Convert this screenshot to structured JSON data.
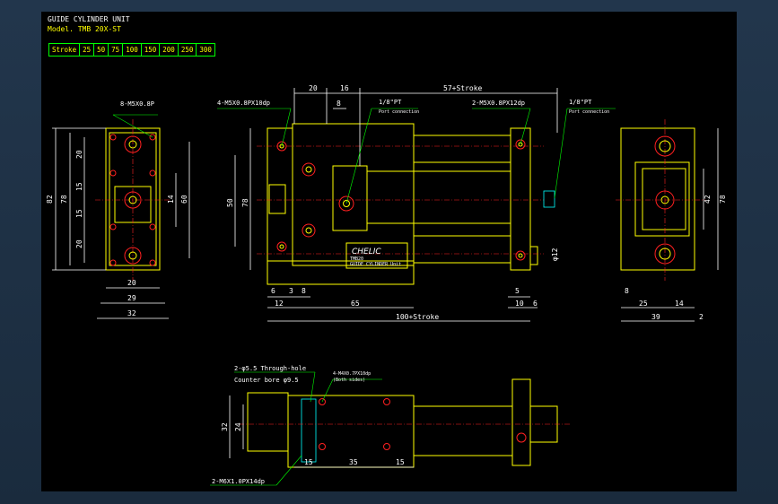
{
  "title": {
    "line1": "GUIDE CYLINDER UNIT",
    "line2": "Model. TMB 20X-ST"
  },
  "stroke_table": {
    "header": "Stroke",
    "values": [
      "25",
      "50",
      "75",
      "100",
      "150",
      "200",
      "250",
      "300"
    ]
  },
  "callouts": {
    "left_top_holes": "8-M5X0.8P",
    "front_top_holes": "4-M5X0.8PX10dp",
    "port_left": "1/8\"PT",
    "port_left_sub": "Port connection",
    "front_right_holes": "2-M5X0.8PX12dp",
    "port_right": "1/8\"PT",
    "port_right_sub": "Port connection",
    "through_hole": "2-φ5.5 Through-hole",
    "counter_bore": "Counter bore φ9.5",
    "bottom_tap": "4-M4X0.7PX10dp",
    "bottom_tap_sub": "(Both sides)",
    "bottom_holes": "2-M6X1.0PX14dp",
    "brand": "CHELIC",
    "plate_line1": "TMB20",
    "plate_line2": "GUIDE CYLINDER Unit"
  },
  "dimensions": {
    "left_view": {
      "height_82": "82",
      "height_78": "78",
      "d20a": "20",
      "d15a": "15",
      "d15b": "15",
      "d20b": "20",
      "d14": "14",
      "d60": "60",
      "w20": "20",
      "w29": "29",
      "w32": "32"
    },
    "front_view": {
      "top20": "20",
      "top16": "16",
      "top8": "8",
      "top57": "57+Stroke",
      "h50": "50",
      "h78": "78",
      "d6a": "6",
      "d3": "3",
      "d8": "8",
      "d12": "12",
      "d65": "65",
      "d100": "100+Stroke",
      "d5": "5",
      "d10": "10",
      "d6b": "6",
      "phi12": "φ12"
    },
    "right_view": {
      "h42": "42",
      "h78": "78",
      "d8": "8",
      "d25": "25",
      "d14": "14",
      "d39": "39",
      "d2": "2"
    },
    "bottom_view": {
      "h32": "32",
      "h24": "24",
      "d15a": "15",
      "d35": "35",
      "d15b": "15"
    }
  },
  "colors": {
    "outline": "#ffff00",
    "dimension": "#ffffff",
    "centerline": "#ff2020",
    "table": "#00ff00",
    "background": "#000000"
  }
}
